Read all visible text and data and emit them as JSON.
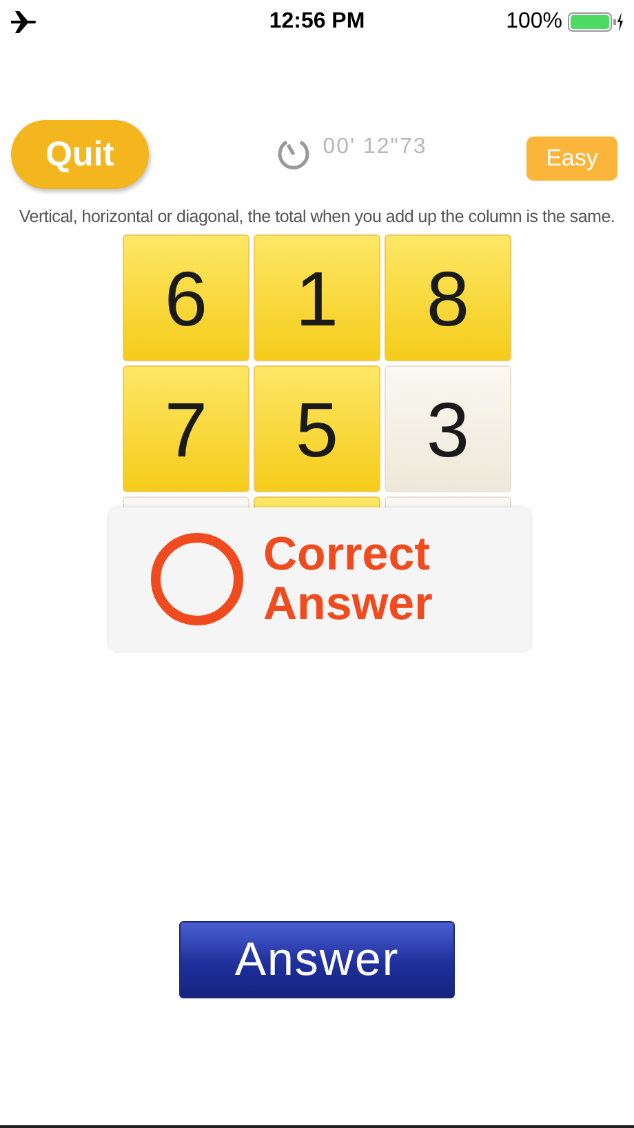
{
  "status_bar": {
    "time": "12:56 PM",
    "battery": "100%"
  },
  "toolbar": {
    "quit": "Quit",
    "timer": "00' 12\"73",
    "difficulty": "Easy"
  },
  "instruction": "Vertical, horizontal or diagonal, the total when you add up the column is the same.",
  "grid": [
    {
      "value": "6",
      "highlighted": true
    },
    {
      "value": "1",
      "highlighted": true
    },
    {
      "value": "8",
      "highlighted": true
    },
    {
      "value": "7",
      "highlighted": true
    },
    {
      "value": "5",
      "highlighted": true
    },
    {
      "value": "3",
      "highlighted": false
    },
    {
      "highlighted": false
    },
    {
      "highlighted": true
    },
    {
      "highlighted": false
    }
  ],
  "result": {
    "line1": "Correct",
    "line2": "Answer"
  },
  "answer_button": "Answer"
}
